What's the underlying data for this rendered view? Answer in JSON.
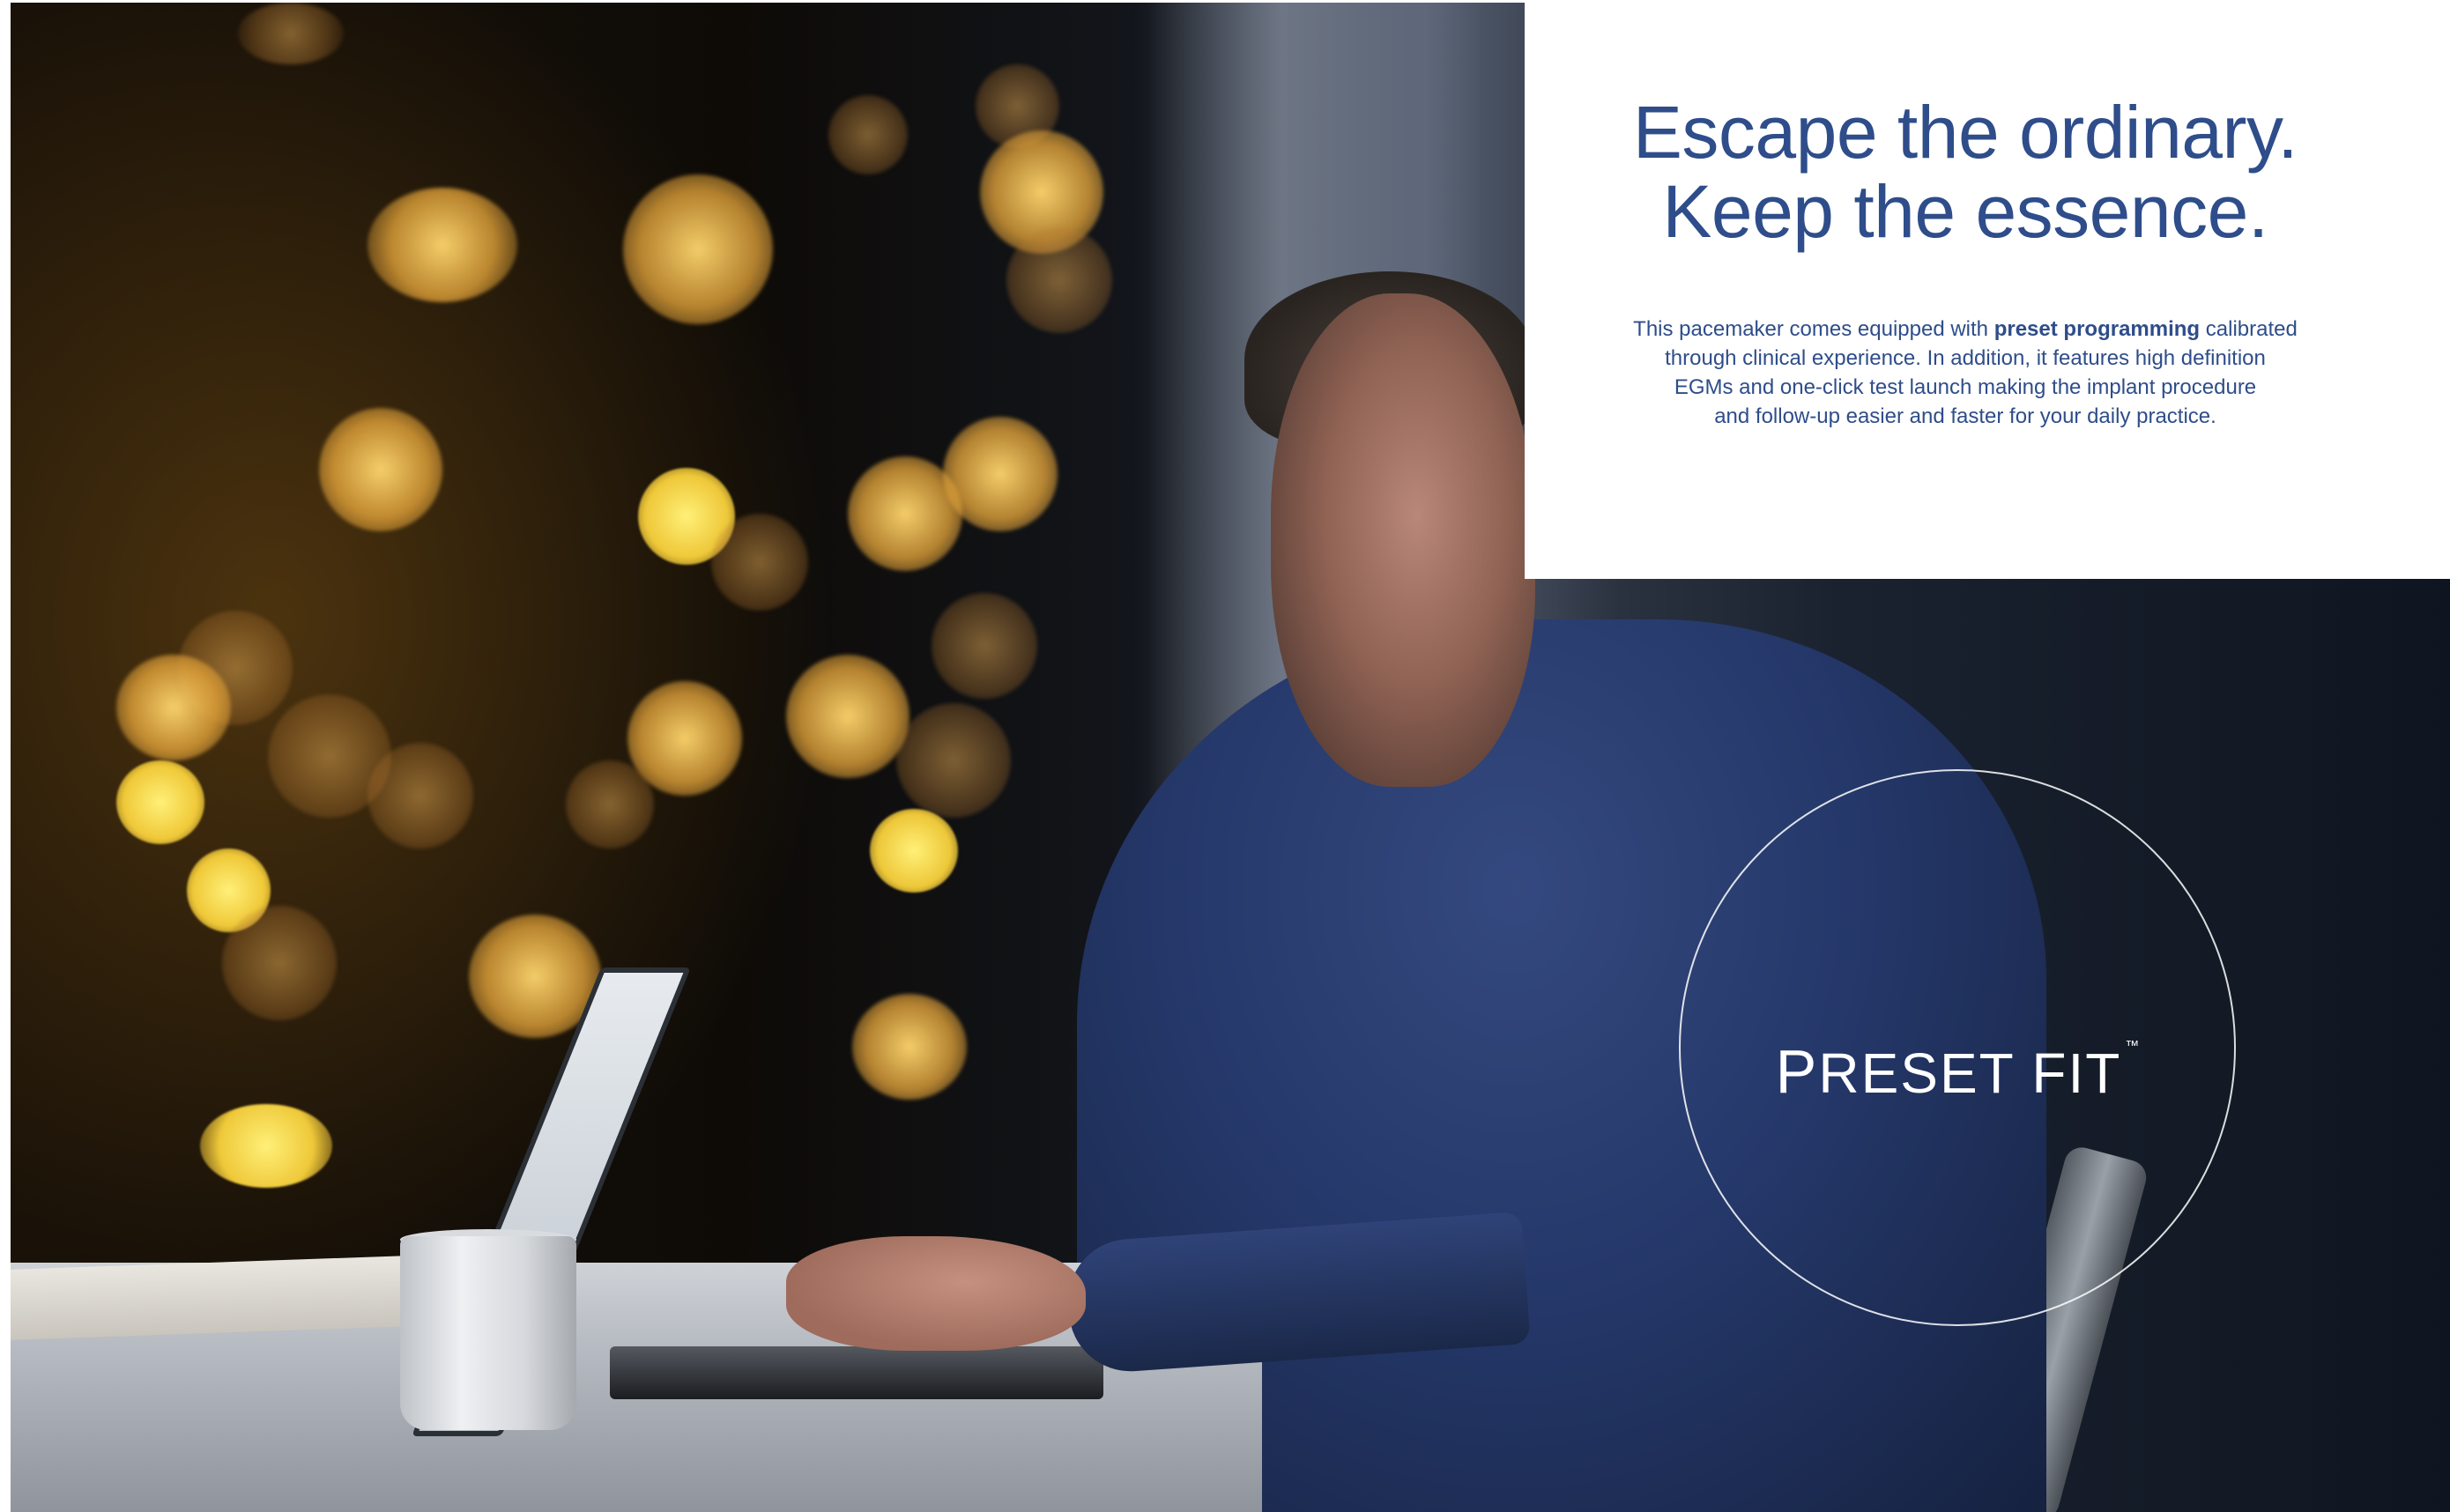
{
  "headline": {
    "line1": "Escape the ordinary.",
    "line2": "Keep the essence."
  },
  "body": {
    "line1_pre": "This pacemaker comes equipped with ",
    "line1_bold": "preset programming",
    "line1_post": " calibrated",
    "line2": "through clinical experience. In addition, it features high definition",
    "line3": "EGMs and one-click test launch making the implant procedure",
    "line4": "and follow-up easier and faster for your daily practice."
  },
  "brand": {
    "initial": "P",
    "rest": "RESET FIT",
    "trademark": "™"
  },
  "colors": {
    "text_blue": "#2e4d8a",
    "card_bg": "#ffffff",
    "brand_text": "#ffffff"
  }
}
